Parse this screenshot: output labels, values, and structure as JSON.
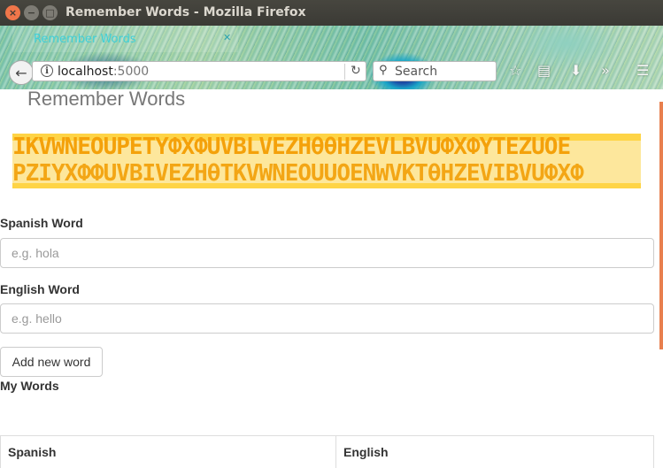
{
  "window": {
    "title": "Remember Words - Mozilla Firefox"
  },
  "browser": {
    "tab_title": "Remember Words",
    "url_host": "localhost",
    "url_port": ":5000",
    "search_placeholder": "Search"
  },
  "page": {
    "title": "Remember Words",
    "banner": {
      "line1": "IKVWNEOUPETYФXФUVBLVEZHθθHZEVLBVUФXФYTEZUOE",
      "line2": "PZIYXФФUVBIVEZHθTKVWNEOUUOENWVKTθHZEVIBVUФXФ"
    },
    "spanish_field": {
      "label": "Spanish Word",
      "placeholder": "e.g. hola"
    },
    "english_field": {
      "label": "English Word",
      "placeholder": "e.g. hello"
    },
    "add_button_label": "Add new word",
    "my_words_title": "My Words",
    "table": {
      "columns": [
        "Spanish",
        "English"
      ]
    }
  },
  "colors": {
    "accent_orange": "#f4a10a",
    "banner_bg": "#fde79c",
    "tab_text": "#3fd0d8"
  }
}
